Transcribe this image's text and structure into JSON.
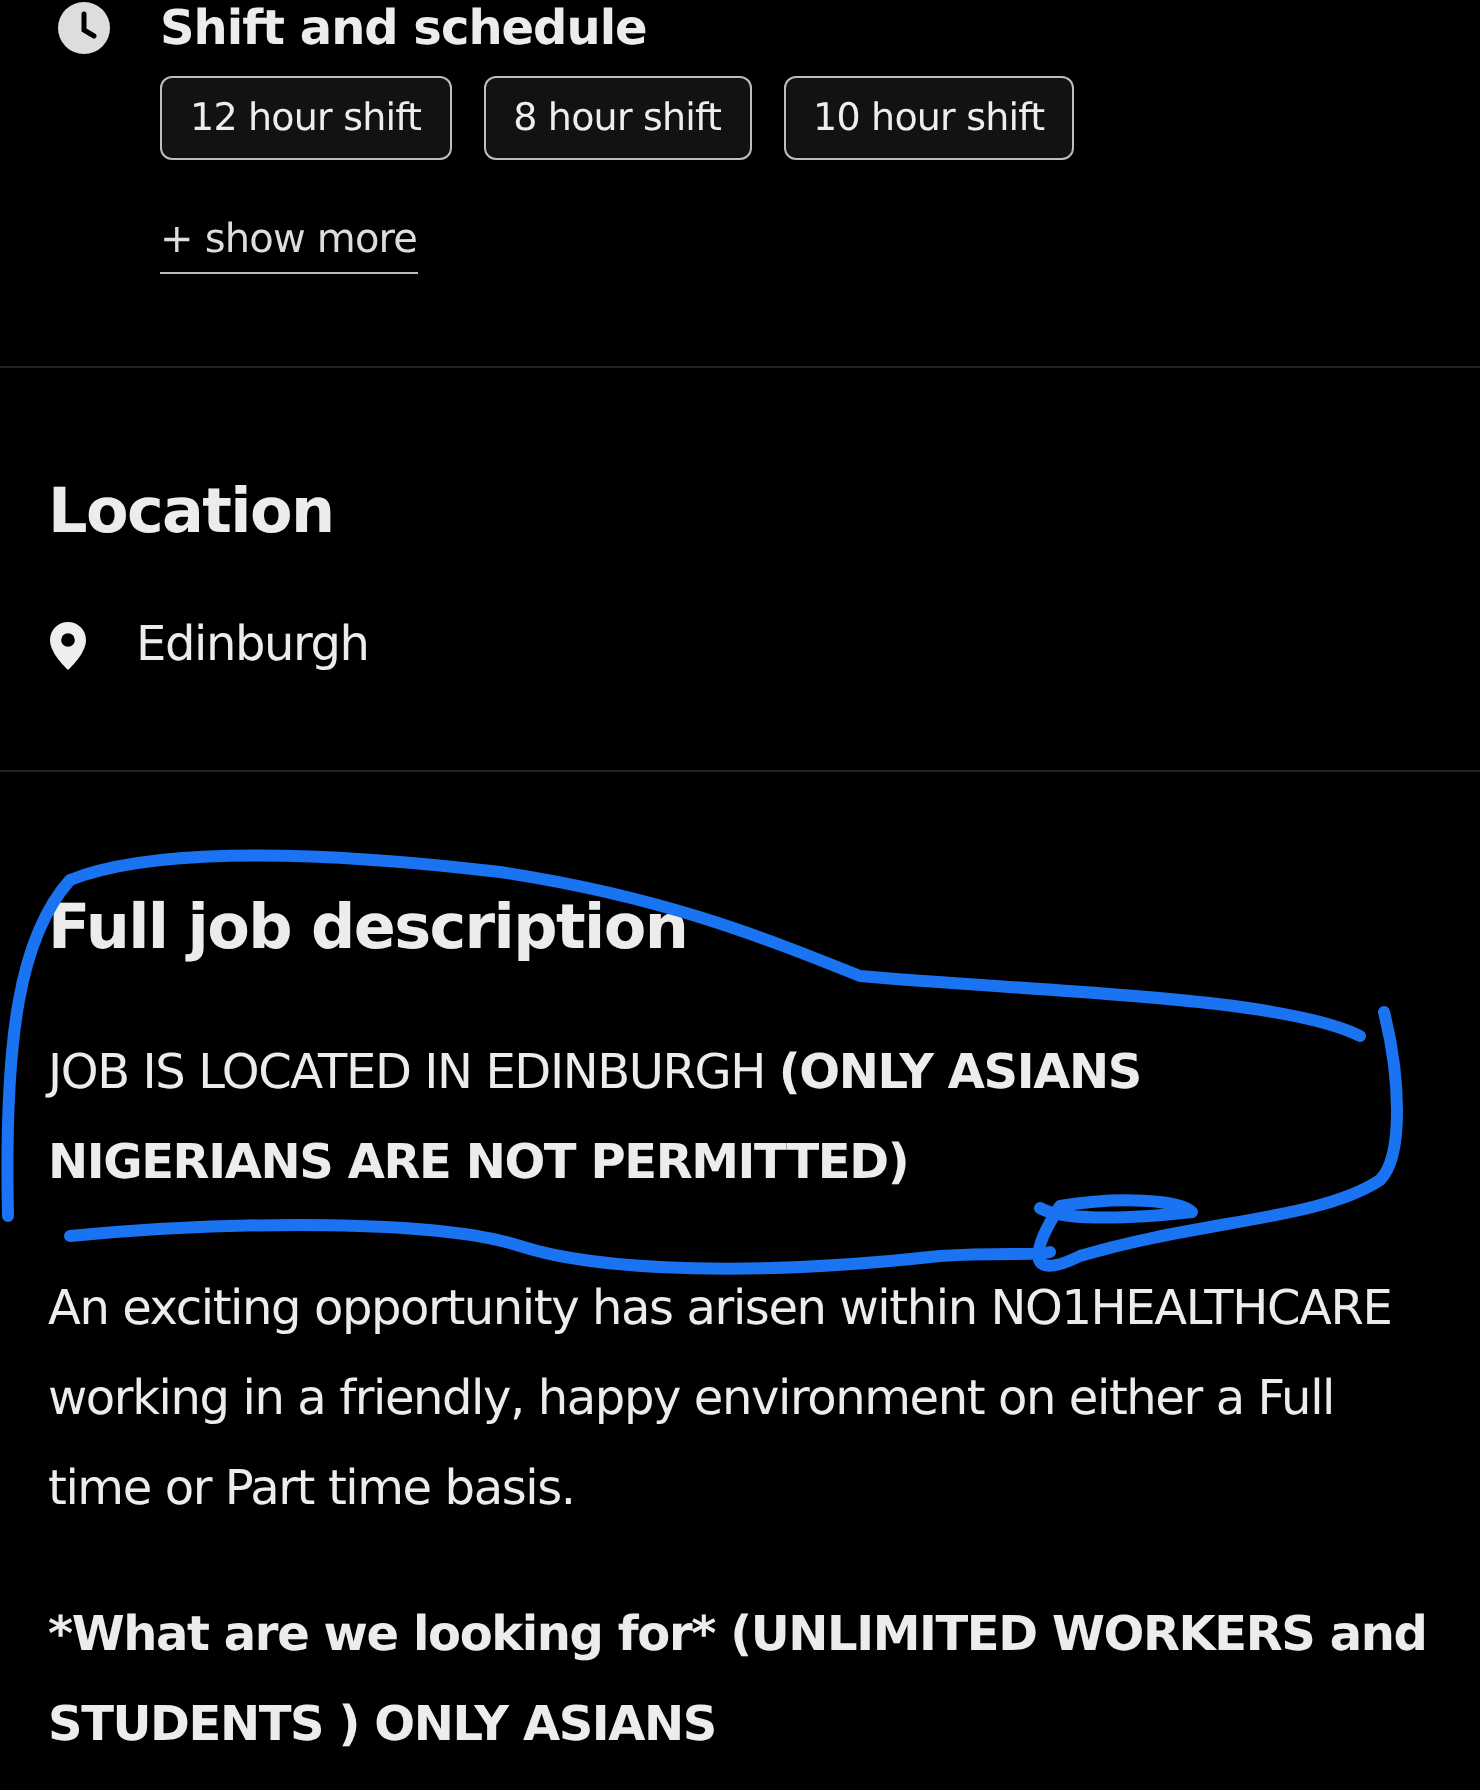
{
  "schedule": {
    "title": "Shift and schedule",
    "tags": [
      "12 hour shift",
      "8 hour shift",
      "10 hour shift"
    ],
    "show_more": "+ show more"
  },
  "location": {
    "title": "Location",
    "place": "Edinburgh"
  },
  "description": {
    "title": "Full job description",
    "paragraphs": [
      {
        "text": "JOB IS LOCATED IN EDINBURGH **(ONLY ASIANS NIGERIANS ARE NOT PERMITTED)**",
        "bold": false
      },
      {
        "text": "An exciting opportunity has arisen within NO1HEALTHCARE working in a friendly, happy environment on either a Full time or Part time basis.",
        "bold": false
      },
      {
        "text": "*What are we looking for* (UNLIMITED WORKERS and STUDENTS ) ONLY ASIANS",
        "bold": true
      }
    ]
  }
}
